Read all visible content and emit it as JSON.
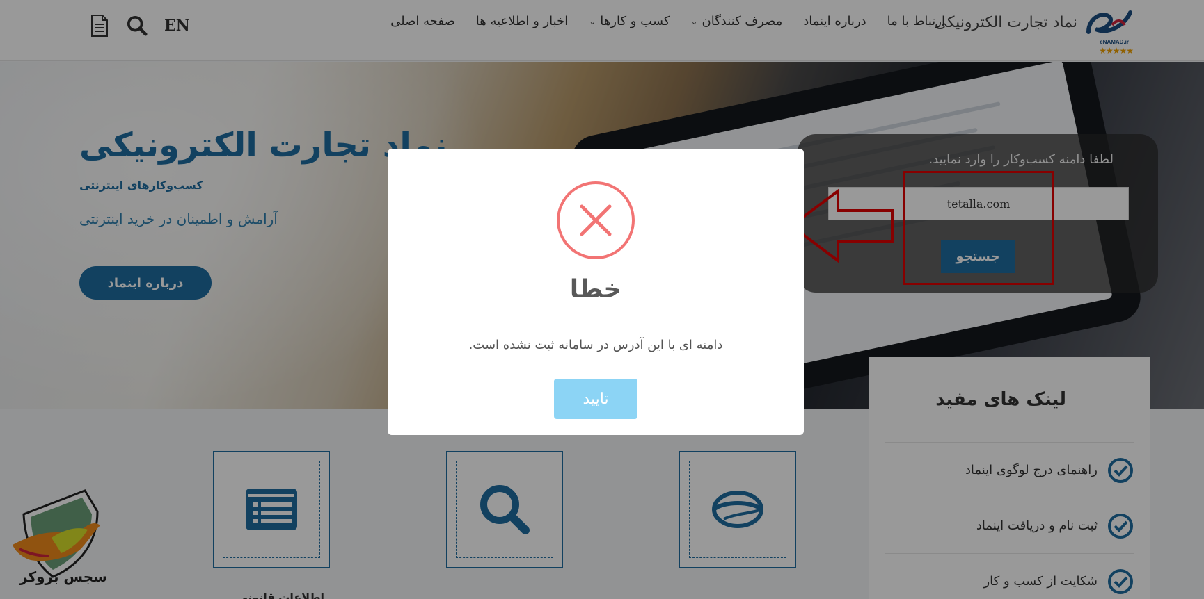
{
  "header": {
    "logo_text": "نماد تجارت الکترونیکی",
    "logo_sub": "eNAMAD.ir",
    "logo_stars": "★★★★★",
    "nav": [
      {
        "label": "صفحه اصلی",
        "dropdown": false
      },
      {
        "label": "اخبار و اطلاعیه ها",
        "dropdown": false
      },
      {
        "label": "کسب و کارها",
        "dropdown": true
      },
      {
        "label": "مصرف کنندگان",
        "dropdown": true
      },
      {
        "label": "درباره اینماد",
        "dropdown": false
      },
      {
        "label": "ارتباط با ما",
        "dropdown": false
      }
    ],
    "lang_label": "EN",
    "icons": [
      "document-icon",
      "search-icon"
    ]
  },
  "hero": {
    "title": "نماد تجارت الکترونیکی",
    "subtitle": "کسب‌وکارهای اینترنتی",
    "tagline": "آرامش و اطمینان در خرید اینترنتی",
    "about_button": "درباره اینماد"
  },
  "search": {
    "label": "لطفا دامنه کسب‌وکار را وارد نمایید.",
    "value": "tetalla.com",
    "button": "جستجو"
  },
  "links": {
    "title": "لینک های مفید",
    "items": [
      "راهنمای درج لوگوی اینماد",
      "ثبت نام و دریافت اینماد",
      "شکایت از کسب و کار"
    ]
  },
  "features": {
    "icons": [
      "list-icon",
      "magnifier-icon",
      "enamad-emblem-icon"
    ],
    "partial_text": "اطلاعات قانونی"
  },
  "watermark": {
    "text": "سجس بروکر"
  },
  "modal": {
    "title": "خطا",
    "message": "دامنه ای با این آدرس در سامانه ثبت نشده است.",
    "confirm": "تایید"
  },
  "colors": {
    "brand": "#1f6da0",
    "error": "#f27474",
    "confirm_button": "#8cd4f5",
    "highlight": "#e20000"
  }
}
